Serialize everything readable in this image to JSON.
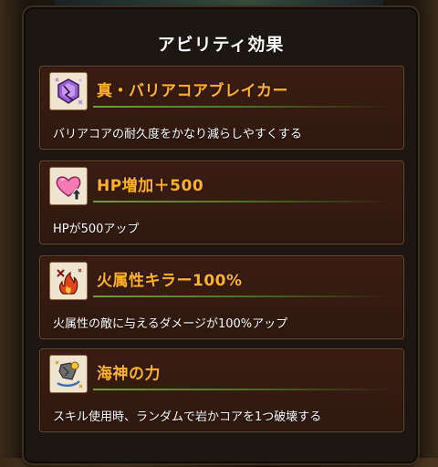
{
  "dialog": {
    "title": "アビリティ効果"
  },
  "abilities": [
    {
      "name": "真・バリアコアブレイカー",
      "description": "バリアコアの耐久度をかなり減らしやすくする",
      "icon": "barrier-breaker-icon"
    },
    {
      "name": "HP増加＋500",
      "description": "HPが500アップ",
      "icon": "heart-up-icon"
    },
    {
      "name": "火属性キラー100%",
      "description": "火属性の敵に与えるダメージが100%アップ",
      "icon": "fire-killer-icon"
    },
    {
      "name": "海神の力",
      "description": "スキル使用時、ランダムで岩かコアを1つ破壊する",
      "icon": "sea-god-icon"
    }
  ],
  "colors": {
    "ability_name": "#ffb12a",
    "card_bg": "#3a1d12",
    "card_border": "#6c4a2f",
    "divider": "#6da13a"
  }
}
